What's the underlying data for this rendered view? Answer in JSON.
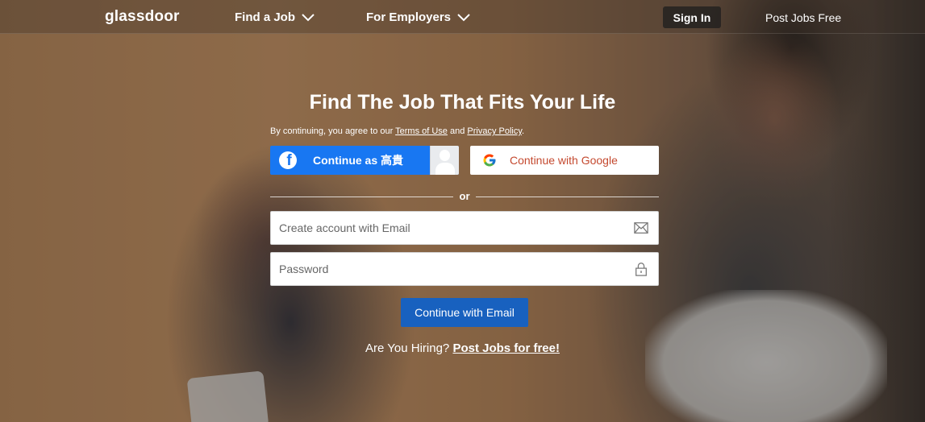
{
  "nav": {
    "logo": "glassdoor",
    "find_job": "Find a Job",
    "for_employers": "For Employers",
    "sign_in": "Sign In",
    "post_jobs": "Post Jobs Free"
  },
  "hero": {
    "headline": "Find The Job That Fits Your Life",
    "terms_prefix": "By continuing, you agree to our ",
    "terms_link": "Terms of Use",
    "terms_and": " and ",
    "privacy_link": "Privacy Policy",
    "terms_suffix": "."
  },
  "social": {
    "facebook_label": "Continue as 高貴",
    "google_label": "Continue with Google"
  },
  "divider": {
    "text": "or"
  },
  "form": {
    "email_placeholder": "Create account with Email",
    "email_value": "",
    "password_placeholder": "Password",
    "password_value": "",
    "submit_label": "Continue with Email"
  },
  "hiring": {
    "question": "Are You Hiring? ",
    "link": "Post Jobs for free!"
  },
  "colors": {
    "facebook_blue": "#1877f2",
    "google_red": "#c4492f",
    "primary_button": "#1861bf"
  },
  "icons": {
    "nav_dropdown": "chevron-down-icon",
    "facebook": "facebook-icon",
    "google": "google-icon",
    "email": "envelope-icon",
    "password": "lock-icon"
  }
}
